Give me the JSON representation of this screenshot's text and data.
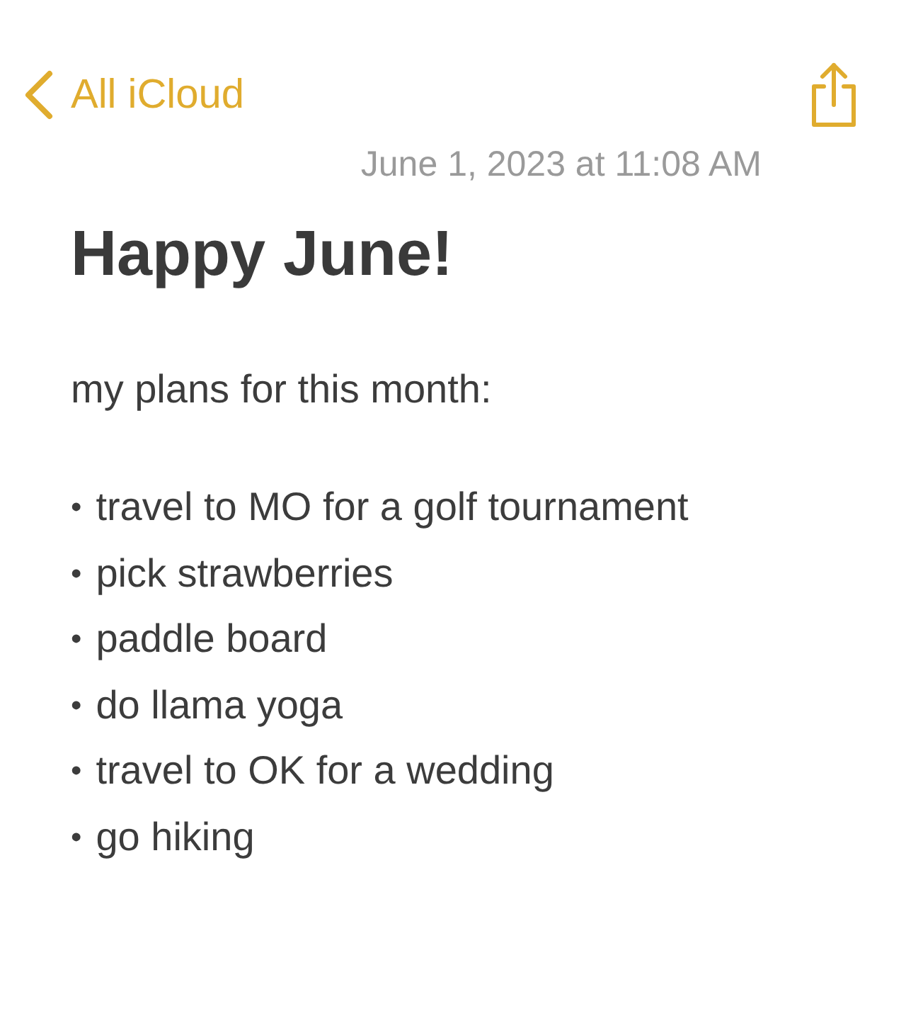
{
  "nav": {
    "back_label": "All iCloud"
  },
  "note": {
    "date": "June 1, 2023 at 11:08 AM",
    "title": "Happy June!",
    "intro": "my plans for this month:",
    "items": [
      {
        "bullet": "•",
        "text": "travel to MO for a golf tournament"
      },
      {
        "bullet": "•",
        "text": "pick strawberries"
      },
      {
        "bullet": "•",
        "text": "paddle board"
      },
      {
        "bullet": "•",
        "text": "do llama yoga"
      },
      {
        "bullet": "•",
        "text": "travel to OK for a wedding"
      },
      {
        "bullet": "•",
        "text": "go hiking"
      }
    ]
  }
}
